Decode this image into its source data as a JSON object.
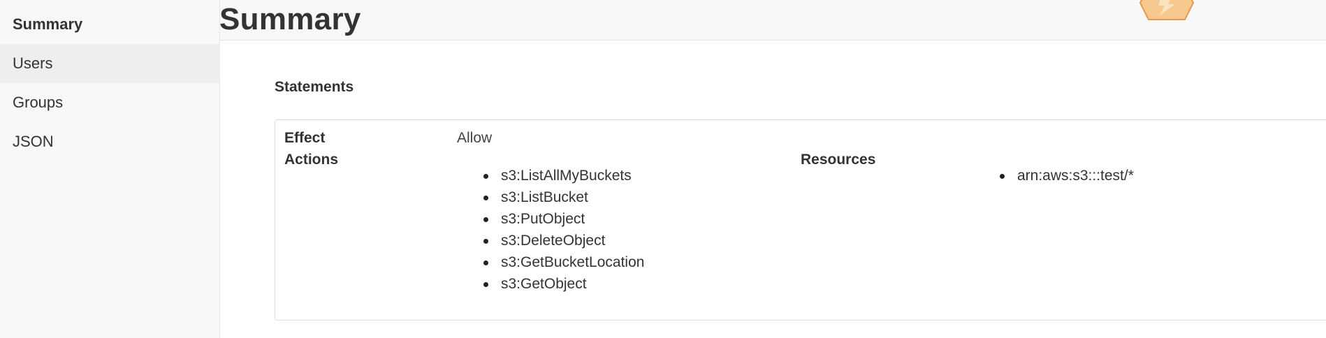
{
  "sidebar": {
    "items": [
      {
        "label": "Summary"
      },
      {
        "label": "Users"
      },
      {
        "label": "Groups"
      },
      {
        "label": "JSON"
      }
    ]
  },
  "page": {
    "title": "Summary"
  },
  "statements": {
    "heading": "Statements",
    "effect_label": "Effect",
    "effect_value": "Allow",
    "actions_label": "Actions",
    "actions": [
      "s3:ListAllMyBuckets",
      "s3:ListBucket",
      "s3:PutObject",
      "s3:DeleteObject",
      "s3:GetBucketLocation",
      "s3:GetObject"
    ],
    "resources_label": "Resources",
    "resources": [
      "arn:aws:s3:::test/*"
    ]
  },
  "icons": {
    "logo": "logo-icon"
  },
  "colors": {
    "sidebar_bg": "#f8f8f8",
    "hover_bg": "#eeeeee",
    "panel_bg": "#ffffff",
    "logo_accent": "#f3a64a"
  }
}
